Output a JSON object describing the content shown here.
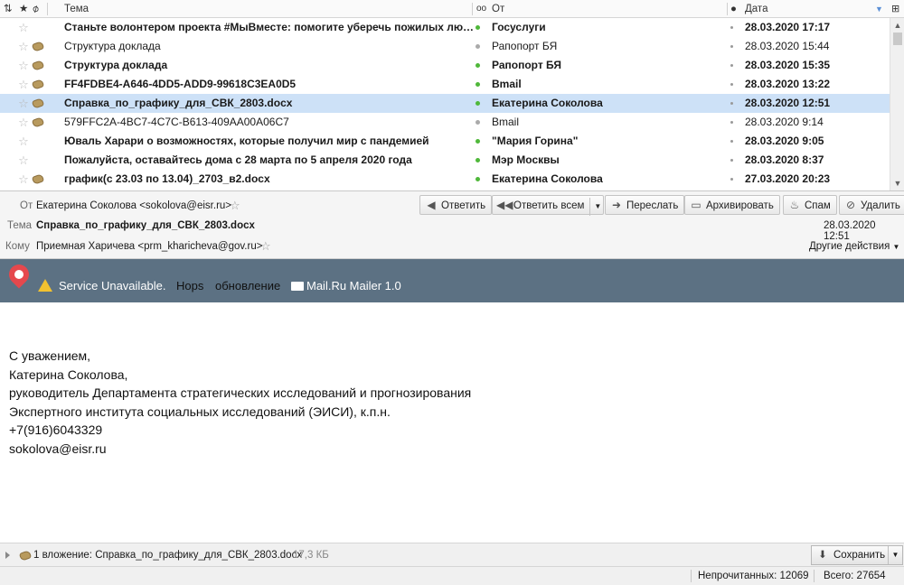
{
  "list_header": {
    "subject": "Тема",
    "from": "От",
    "date": "Дата"
  },
  "messages": [
    {
      "subject": "Станьте волонтером проекта #МыВместе: помогите уберечь пожилых людей от коронавируса",
      "from": "Госуслуги",
      "date": "28.03.2020 17:17",
      "unread": true,
      "attachment": false,
      "selected": false
    },
    {
      "subject": "Структура доклада",
      "from": "Рапопорт БЯ",
      "date": "28.03.2020 15:44",
      "unread": false,
      "attachment": true,
      "selected": false
    },
    {
      "subject": "Структура доклада",
      "from": "Рапопорт БЯ",
      "date": "28.03.2020 15:35",
      "unread": true,
      "attachment": true,
      "selected": false
    },
    {
      "subject": "FF4FDBE4-A646-4DD5-ADD9-99618C3EA0D5",
      "from": "Bmail",
      "date": "28.03.2020 13:22",
      "unread": true,
      "attachment": true,
      "selected": false
    },
    {
      "subject": "Справка_по_графику_для_СВК_2803.docx",
      "from": "Екатерина Соколова",
      "date": "28.03.2020 12:51",
      "unread": true,
      "attachment": true,
      "selected": true
    },
    {
      "subject": "579FFC2A-4BC7-4C7C-B613-409AA00A06C7",
      "from": "Bmail",
      "date": "28.03.2020 9:14",
      "unread": false,
      "attachment": true,
      "selected": false
    },
    {
      "subject": "Юваль Харари о возможностях, которые получил мир с пандемией",
      "from": "\"Мария Горина\"",
      "date": "28.03.2020 9:05",
      "unread": true,
      "attachment": false,
      "selected": false
    },
    {
      "subject": "Пожалуйста, оставайтесь дома с 28 марта по 5 апреля 2020 года",
      "from": "Мэр Москвы",
      "date": "28.03.2020 8:37",
      "unread": true,
      "attachment": false,
      "selected": false
    },
    {
      "subject": "график(с 23.03 по 13.04)_2703_в2.docx",
      "from": "Екатерина Соколова",
      "date": "27.03.2020 20:23",
      "unread": true,
      "attachment": true,
      "selected": false
    }
  ],
  "header": {
    "from_label": "От",
    "from_value": "Екатерина Соколова <sokolova@eisr.ru>",
    "subject_label": "Тема",
    "subject_value": "Справка_по_графику_для_СВК_2803.docx",
    "date_value": "28.03.2020 12:51",
    "to_label": "Кому",
    "to_value": "Приемная Харичева <prm_kharicheva@gov.ru>",
    "other_actions": "Другие действия"
  },
  "toolbar": {
    "reply": "Ответить",
    "reply_all": "Ответить всем",
    "forward": "Переслать",
    "archive": "Архивировать",
    "spam": "Спам",
    "delete": "Удалить"
  },
  "banner": {
    "service": "Service Unavailable.",
    "hops": "Hops",
    "update": "обновление",
    "mailer": "Mail.Ru Mailer 1.0",
    "bg_color": "#5c7183"
  },
  "body": {
    "lines": [
      "С уважением,",
      "Катерина Соколова,",
      "руководитель Департамента стратегических исследований и прогнозирования",
      "Экспертного института социальных исследований (ЭИСИ), к.п.н.",
      "+7(916)6043329",
      "sokolova@eisr.ru"
    ]
  },
  "attachment": {
    "text": "1 вложение: Справка_по_графику_для_СВК_2803.docx",
    "size": "17,3 КБ",
    "save": "Сохранить"
  },
  "status": {
    "unread": "Непрочитанных: 12069",
    "total": "Всего: 27654"
  },
  "colors": {
    "selected_row": "#cde1f7",
    "unread_dot": "#4fb83a"
  }
}
